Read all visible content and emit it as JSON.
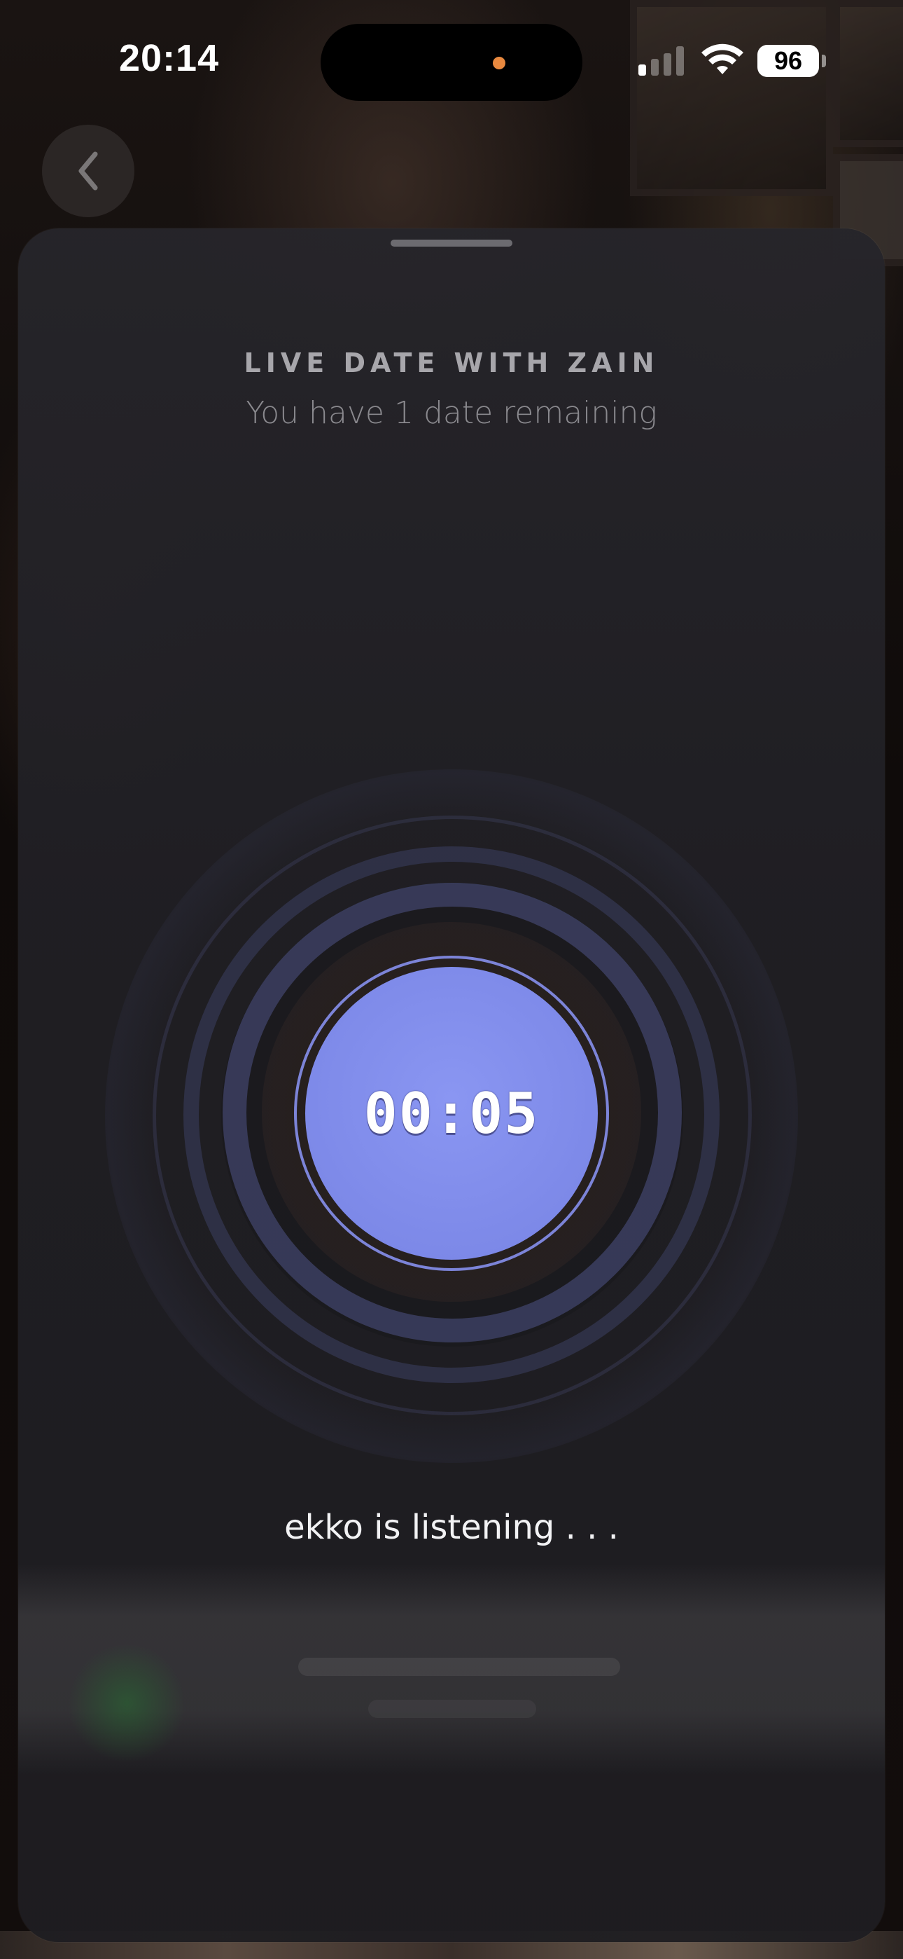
{
  "status_bar": {
    "time": "20:14",
    "battery": "96",
    "signal_bars_active": 1,
    "signal_bars_total": 4
  },
  "icons": {
    "back": "chevron-left-icon",
    "wifi": "wifi-icon",
    "signal": "cellular-signal-icon",
    "battery": "battery-icon"
  },
  "sheet": {
    "title": "LIVE DATE WITH ZAIN",
    "subtitle": "You have 1 date remaining",
    "timer": "00:05",
    "status": "ekko is listening . . ."
  },
  "colors": {
    "accent": "#7f8be9",
    "ring": "#3a3d5c",
    "sheet_background": "#252429",
    "recording_dot": "#e9893f"
  }
}
